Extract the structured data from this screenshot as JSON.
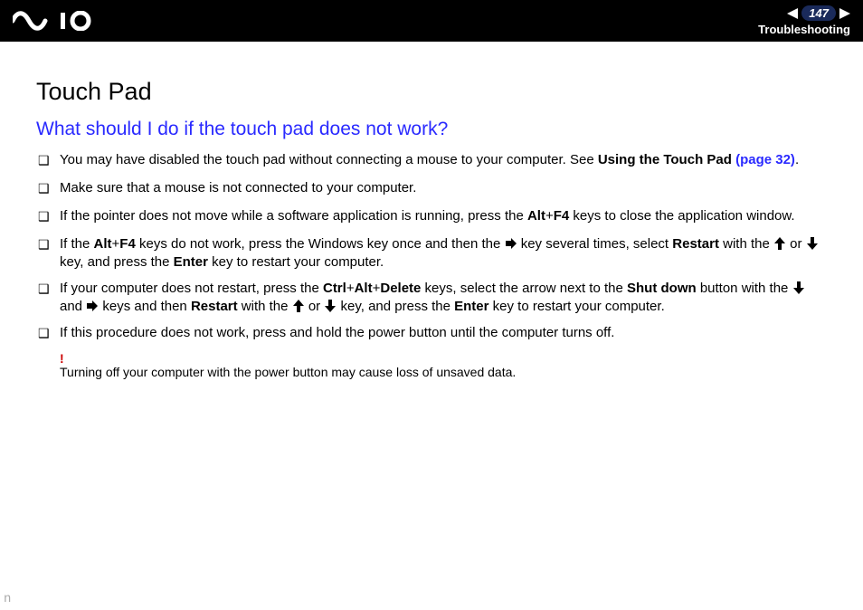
{
  "header": {
    "page_number": "147",
    "section": "Troubleshooting"
  },
  "content": {
    "h1": "Touch Pad",
    "h2": "What should I do if the touch pad does not work?",
    "items": [
      {
        "segments": [
          {
            "t": "You may have disabled the touch pad without connecting a mouse to your computer. See "
          },
          {
            "t": "Using the Touch Pad ",
            "b": true
          },
          {
            "t": "(page 32)",
            "link": true
          },
          {
            "t": "."
          }
        ]
      },
      {
        "segments": [
          {
            "t": "Make sure that a mouse is not connected to your computer."
          }
        ]
      },
      {
        "segments": [
          {
            "t": "If the pointer does not move while a software application is running, press the "
          },
          {
            "t": "Alt",
            "b": true
          },
          {
            "t": "+"
          },
          {
            "t": "F4",
            "b": true
          },
          {
            "t": " keys to close the application window."
          }
        ]
      },
      {
        "segments": [
          {
            "t": "If the "
          },
          {
            "t": "Alt",
            "b": true
          },
          {
            "t": "+"
          },
          {
            "t": "F4",
            "b": true
          },
          {
            "t": " keys do not work, press the Windows key once and then the "
          },
          {
            "icon": "right"
          },
          {
            "t": " key several times, select "
          },
          {
            "t": "Restart",
            "b": true
          },
          {
            "t": " with the "
          },
          {
            "icon": "up"
          },
          {
            "t": " or "
          },
          {
            "icon": "down"
          },
          {
            "t": " key, and press the "
          },
          {
            "t": "Enter",
            "b": true
          },
          {
            "t": " key to restart your computer."
          }
        ]
      },
      {
        "segments": [
          {
            "t": "If your computer does not restart, press the "
          },
          {
            "t": "Ctrl",
            "b": true
          },
          {
            "t": "+"
          },
          {
            "t": "Alt",
            "b": true
          },
          {
            "t": "+"
          },
          {
            "t": "Delete",
            "b": true
          },
          {
            "t": " keys, select the arrow next to the "
          },
          {
            "t": "Shut down",
            "b": true
          },
          {
            "t": " button with the "
          },
          {
            "icon": "down"
          },
          {
            "t": " and "
          },
          {
            "icon": "right"
          },
          {
            "t": " keys and then "
          },
          {
            "t": "Restart",
            "b": true
          },
          {
            "t": " with the "
          },
          {
            "icon": "up"
          },
          {
            "t": " or "
          },
          {
            "icon": "down"
          },
          {
            "t": " key, and press the "
          },
          {
            "t": "Enter",
            "b": true
          },
          {
            "t": " key to restart your computer."
          }
        ]
      },
      {
        "segments": [
          {
            "t": "If this procedure does not work, press and hold the power button until the computer turns off."
          }
        ]
      }
    ],
    "warning_mark": "!",
    "warning_text": "Turning off your computer with the power button may cause loss of unsaved data."
  },
  "corner_marker": "n"
}
